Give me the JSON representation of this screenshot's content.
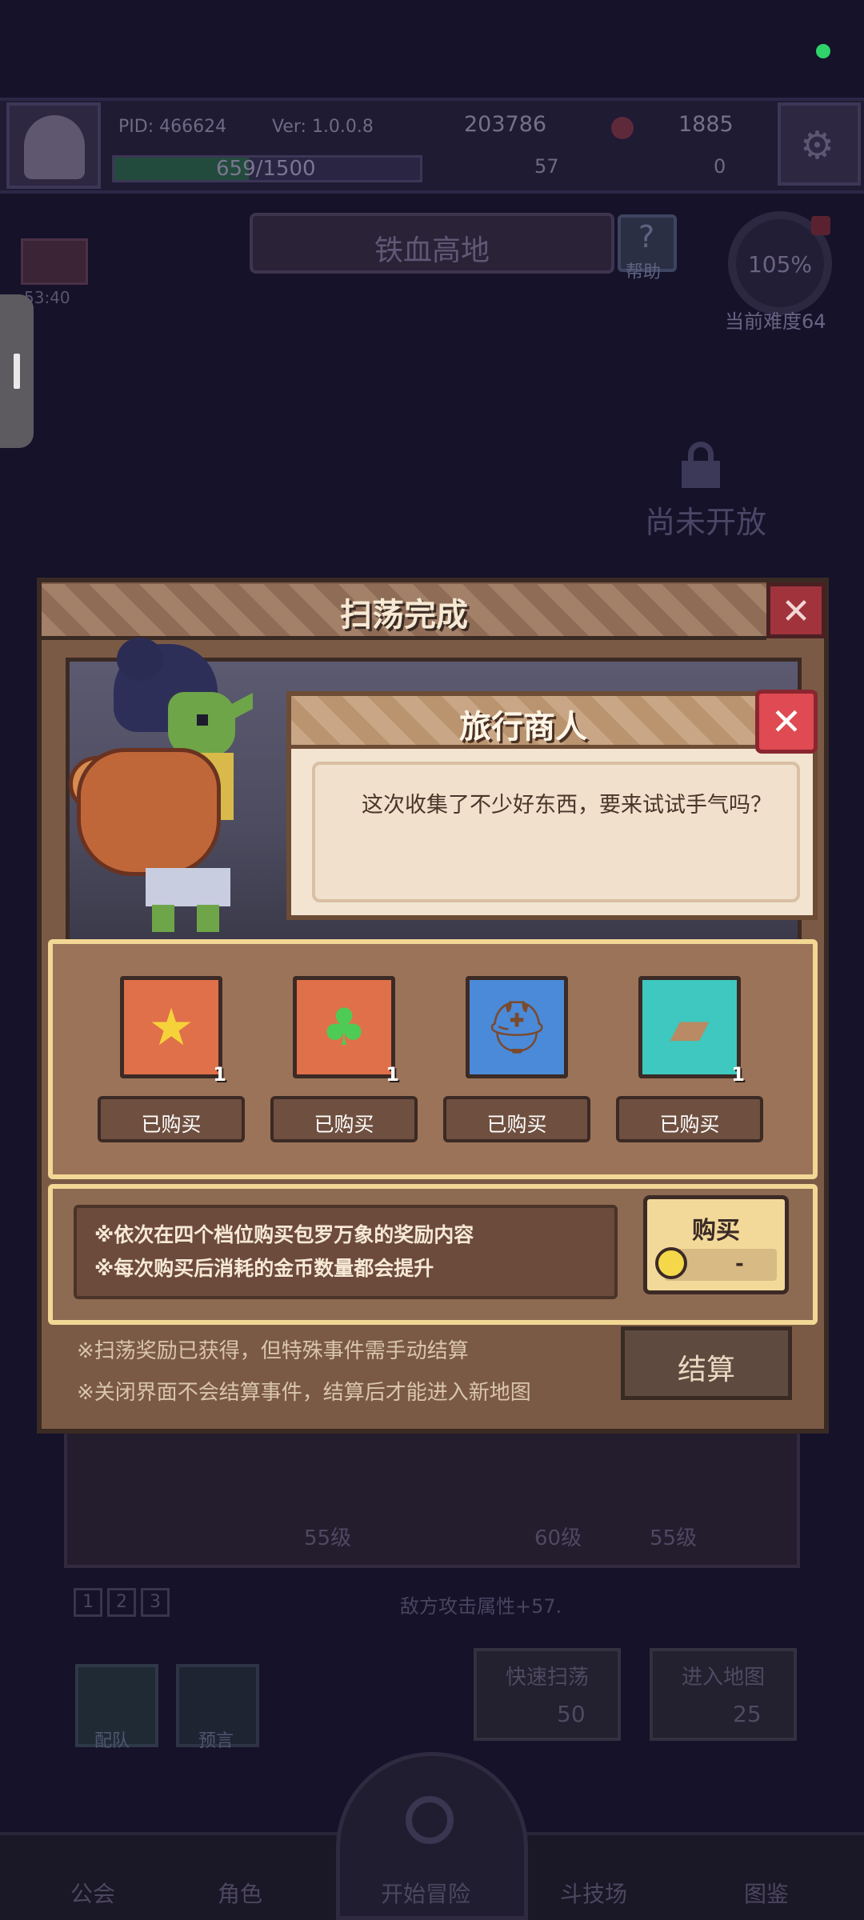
{
  "status": {
    "indicator_color": "#2fd36a"
  },
  "header": {
    "pid": "PID: 466624",
    "version": "Ver: 1.0.0.8",
    "gold": "203786",
    "gems": "1885",
    "exp": "659/1500",
    "exp_ratio": 0.44,
    "clovers": "57",
    "keys": "0"
  },
  "stage": {
    "name": "铁血高地",
    "help_label": "帮助",
    "chest_timer": "53:40",
    "difficulty_percent": "105%",
    "difficulty_label": "当前难度64",
    "locked_label": "尚未开放"
  },
  "background": {
    "levels": [
      "55级",
      "60级",
      "55级"
    ],
    "pages": [
      "1",
      "2",
      "3"
    ],
    "enemy_attr": "敌方攻击属性+57.",
    "team_label": "配队",
    "preview_label": "预言",
    "quick_sweep": {
      "label": "快速扫荡",
      "cost": "50"
    },
    "enter_map": {
      "label": "进入地图",
      "cost": "25"
    }
  },
  "nav": {
    "items": [
      "公会",
      "角色",
      "开始冒险",
      "斗技场",
      "图鉴"
    ]
  },
  "dialog": {
    "title": "扫荡完成",
    "close_icon": "close-icon",
    "notes": [
      "※扫荡奖励已获得，但特殊事件需手动结算",
      "※关闭界面不会结算事件，结算后才能进入新地图"
    ],
    "settle_label": "结算"
  },
  "merchant": {
    "title": "旅行商人",
    "message": "这次收集了不少好东西，要来试试手气吗？"
  },
  "shop": {
    "slots": [
      {
        "icon": "star-icon",
        "glyph": "★",
        "qty": "1",
        "state": "已购买",
        "bg": "#e0704a",
        "glyph_color": "#f6d23a"
      },
      {
        "icon": "clover-icon",
        "glyph": "♣",
        "qty": "1",
        "state": "已购买",
        "bg": "#e0704a",
        "glyph_color": "#4ecb56"
      },
      {
        "icon": "viking-helmet-icon",
        "glyph": "⛑",
        "qty": "",
        "state": "已购买",
        "bg": "#4b8ad8",
        "glyph_color": "#7a4a2e"
      },
      {
        "icon": "treasure-chest-icon",
        "glyph": "▰",
        "qty": "1",
        "state": "已购买",
        "bg": "#3ec8bf",
        "glyph_color": "#b98a63"
      }
    ],
    "rules": [
      "※依次在四个档位购买包罗万象的奖励内容",
      "※每次购买后消耗的金币数量都会提升"
    ],
    "buy_label": "购买",
    "price": "-"
  }
}
